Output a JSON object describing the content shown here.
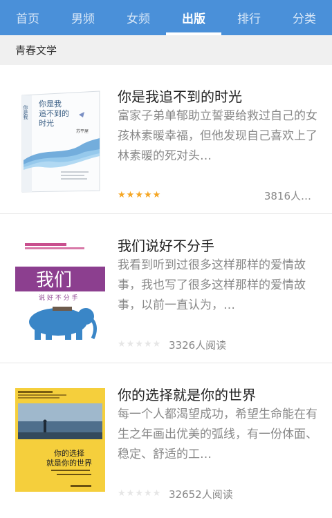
{
  "tabs": [
    {
      "label": "首页",
      "active": false
    },
    {
      "label": "男频",
      "active": false
    },
    {
      "label": "女频",
      "active": false
    },
    {
      "label": "出版",
      "active": true
    },
    {
      "label": "排行",
      "active": false
    },
    {
      "label": "分类",
      "active": false
    }
  ],
  "section": {
    "title": "青春文学"
  },
  "books": [
    {
      "title": "你是我追不到的时光",
      "description": "富家子弟单郁助立誓要给救过自己的女孩林素暖幸福，但他发现自己喜欢上了林素暖的死对头…",
      "rating": 5,
      "readers": "3816人…",
      "cover_text": {
        "title_lines": [
          "你是我",
          "追不到的",
          "时光"
        ],
        "author": "苏平屋"
      }
    },
    {
      "title": "我们说好不分手",
      "description": "我看到听到过很多这样那样的爱情故事，我也写了很多这样那样的爱情故事，以前一直认为，…",
      "rating": 0,
      "readers": "3326人阅读",
      "cover_text": {
        "title": "我们",
        "subtitle": "说 好 不 分 手"
      }
    },
    {
      "title": "你的选择就是你的世界",
      "description": "每一个人都渴望成功，希望生命能在有生之年画出优美的弧线，有一份体面、稳定、舒适的工…",
      "rating": 0,
      "readers": "32652人阅读",
      "cover_text": {
        "title_lines": [
          "你的选择",
          "就是你的世界"
        ]
      }
    }
  ],
  "colors": {
    "accent": "#4a90d9",
    "star_on": "#f5a623",
    "star_off": "#e6e6e6"
  }
}
